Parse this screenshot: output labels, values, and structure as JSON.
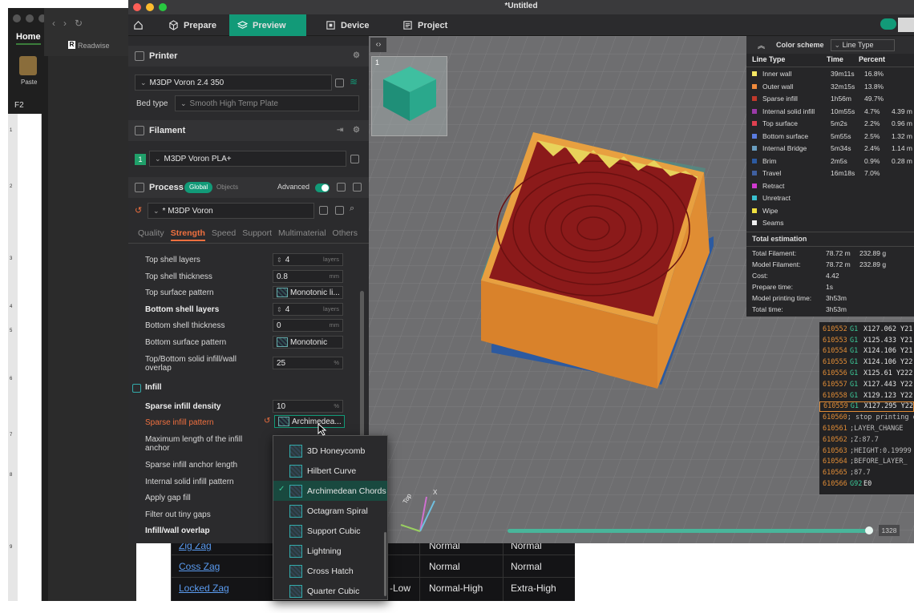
{
  "window": {
    "title": "*Untitled"
  },
  "excel": {
    "home_tab": "Home",
    "paste_label": "Paste",
    "cell_ref": "F2",
    "row_numbers": [
      "1",
      "2",
      "3",
      "4",
      "5",
      "6",
      "7",
      "8",
      "9"
    ],
    "readwise_label": "Readwise"
  },
  "tabs": [
    {
      "label": "Prepare",
      "icon": "cube-icon"
    },
    {
      "label": "Preview",
      "icon": "layers-icon"
    },
    {
      "label": "Device",
      "icon": "device-icon"
    },
    {
      "label": "Project",
      "icon": "project-icon"
    }
  ],
  "printer": {
    "section_title": "Printer",
    "selected": "M3DP Voron 2.4 350",
    "bed_type_label": "Bed type",
    "bed_type_value": "Smooth High Temp Plate"
  },
  "filament": {
    "section_title": "Filament",
    "slot_number": "1",
    "selected": "M3DP Voron PLA+"
  },
  "process": {
    "section_title": "Process",
    "pill_global": "Global",
    "pill_objects": "Objects",
    "advanced_label": "Advanced",
    "preset": "* M3DP Voron",
    "subtabs": [
      "Quality",
      "Strength",
      "Speed",
      "Support",
      "Multimaterial",
      "Others"
    ],
    "active_subtab": "Strength"
  },
  "settings": {
    "top_shell_layers": {
      "label": "Top shell layers",
      "value": "4",
      "unit": "layers"
    },
    "top_shell_thickness": {
      "label": "Top shell thickness",
      "value": "0.8",
      "unit": "mm"
    },
    "top_surface_pattern": {
      "label": "Top surface pattern",
      "value": "Monotonic li..."
    },
    "bottom_shell_layers": {
      "label": "Bottom shell layers",
      "value": "4",
      "unit": "layers"
    },
    "bottom_shell_thickness": {
      "label": "Bottom shell thickness",
      "value": "0",
      "unit": "mm"
    },
    "bottom_surface_pattern": {
      "label": "Bottom surface pattern",
      "value": "Monotonic"
    },
    "top_bottom_overlap": {
      "label": "Top/Bottom solid infill/wall overlap",
      "value": "25",
      "unit": "%"
    },
    "infill_group": "Infill",
    "sparse_infill_density": {
      "label": "Sparse infill density",
      "value": "10",
      "unit": "%"
    },
    "sparse_infill_pattern": {
      "label": "Sparse infill pattern",
      "value": "Archimedea..."
    },
    "max_infill_anchor": {
      "label": "Maximum length of the infill anchor"
    },
    "sparse_infill_anchor_length": {
      "label": "Sparse infill anchor length"
    },
    "internal_solid_infill_pattern": {
      "label": "Internal solid infill pattern"
    },
    "apply_gap_fill": {
      "label": "Apply gap fill"
    },
    "filter_tiny_gaps": {
      "label": "Filter out tiny gaps"
    },
    "infill_wall_overlap": {
      "label": "Infill/wall overlap"
    }
  },
  "pattern_dropdown": {
    "options": [
      "3D Honeycomb",
      "Hilbert Curve",
      "Archimedean Chords",
      "Octagram Spiral",
      "Support Cubic",
      "Lightning",
      "Cross Hatch",
      "Quarter Cubic"
    ],
    "selected": "Archimedean Chords"
  },
  "thumbnail": {
    "plate_number": "1"
  },
  "legend": {
    "title": "Color scheme",
    "scheme": "Line Type",
    "columns": {
      "type": "Line Type",
      "time": "Time",
      "percent": "Percent"
    },
    "rows": [
      {
        "name": "Inner wall",
        "time": "39m11s",
        "percent": "16.8%",
        "extra": "",
        "color": "#f5e663"
      },
      {
        "name": "Outer wall",
        "time": "32m15s",
        "percent": "13.8%",
        "extra": "",
        "color": "#f08a3c"
      },
      {
        "name": "Sparse infill",
        "time": "1h56m",
        "percent": "49.7%",
        "extra": "",
        "color": "#c0392b"
      },
      {
        "name": "Internal solid infill",
        "time": "10m55s",
        "percent": "4.7%",
        "extra": "4.39 m",
        "color": "#9b3aa8"
      },
      {
        "name": "Top surface",
        "time": "5m2s",
        "percent": "2.2%",
        "extra": "0.96 m",
        "color": "#e04050"
      },
      {
        "name": "Bottom surface",
        "time": "5m55s",
        "percent": "2.5%",
        "extra": "1.32 m",
        "color": "#5a7be0"
      },
      {
        "name": "Internal Bridge",
        "time": "5m34s",
        "percent": "2.4%",
        "extra": "1.14 m",
        "color": "#6a9ec0"
      },
      {
        "name": "Brim",
        "time": "2m5s",
        "percent": "0.9%",
        "extra": "0.28 m",
        "color": "#2c5aa0"
      },
      {
        "name": "Travel",
        "time": "16m18s",
        "percent": "7.0%",
        "extra": "",
        "color": "#3f5f9f"
      },
      {
        "name": "Retract",
        "time": "",
        "percent": "",
        "extra": "",
        "color": "#d03ad0"
      },
      {
        "name": "Unretract",
        "time": "",
        "percent": "",
        "extra": "",
        "color": "#3ac0d0"
      },
      {
        "name": "Wipe",
        "time": "",
        "percent": "",
        "extra": "",
        "color": "#f0e040"
      },
      {
        "name": "Seams",
        "time": "",
        "percent": "",
        "extra": "",
        "color": "#f0f0f0"
      }
    ],
    "total_title": "Total estimation",
    "totals": [
      {
        "k": "Total Filament:",
        "v1": "78.72 m",
        "v2": "232.89 g"
      },
      {
        "k": "Model Filament:",
        "v1": "78.72 m",
        "v2": "232.89 g"
      },
      {
        "k": "Cost:",
        "v1": "4.42",
        "v2": ""
      },
      {
        "k": "Prepare time:",
        "v1": "1s",
        "v2": ""
      },
      {
        "k": "Model printing time:",
        "v1": "3h53m",
        "v2": ""
      },
      {
        "k": "Total time:",
        "v1": "3h53m",
        "v2": ""
      }
    ]
  },
  "gcode": [
    {
      "ln": "610552",
      "cmd": "G1",
      "arg": "X127.062 Y21"
    },
    {
      "ln": "610553",
      "cmd": "G1",
      "arg": "X125.433 Y21"
    },
    {
      "ln": "610554",
      "cmd": "G1",
      "arg": "X124.106 Y21"
    },
    {
      "ln": "610555",
      "cmd": "G1",
      "arg": "X124.106 Y22"
    },
    {
      "ln": "610556",
      "cmd": "G1",
      "arg": "X125.61 Y222"
    },
    {
      "ln": "610557",
      "cmd": "G1",
      "arg": "X127.443 Y22"
    },
    {
      "ln": "610558",
      "cmd": "G1",
      "arg": "X129.123 Y22"
    },
    {
      "ln": "610559",
      "cmd": "G1",
      "arg": "X127.295 Y22"
    },
    {
      "ln": "610560",
      "cmd": "",
      "arg": "; stop printing ob"
    },
    {
      "ln": "610561",
      "cmd": "",
      "arg": ";LAYER_CHANGE"
    },
    {
      "ln": "610562",
      "cmd": "",
      "arg": ";Z:87.7"
    },
    {
      "ln": "610563",
      "cmd": "",
      "arg": ";HEIGHT:0.19999"
    },
    {
      "ln": "610564",
      "cmd": "",
      "arg": ";BEFORE_LAYER_"
    },
    {
      "ln": "610565",
      "cmd": "",
      "arg": ";87.7"
    },
    {
      "ln": "610566",
      "cmd": "G92",
      "arg": "E0"
    }
  ],
  "gcode_current_index": 7,
  "layer_slider": {
    "value": "1328",
    "fraction": 0.99
  },
  "axis_labels": {
    "top": "Top",
    "x": "X"
  },
  "bottom_table": {
    "rows": [
      {
        "name": "Zig Zag",
        "c2": "",
        "c3": "Normal",
        "c4": "Normal"
      },
      {
        "name": "Coss Zag",
        "c2": "",
        "c3": "Normal",
        "c4": "Normal"
      },
      {
        "name": "Locked Zag",
        "c2": "-Low",
        "c3": "Normal-High",
        "c4": "Extra-High"
      }
    ]
  },
  "colors": {
    "accent": "#129a78",
    "strength_tab": "#f0703f",
    "box_wall": "#d9822b",
    "box_infill": "#8b1a1a",
    "brim": "#2c5aa0"
  }
}
